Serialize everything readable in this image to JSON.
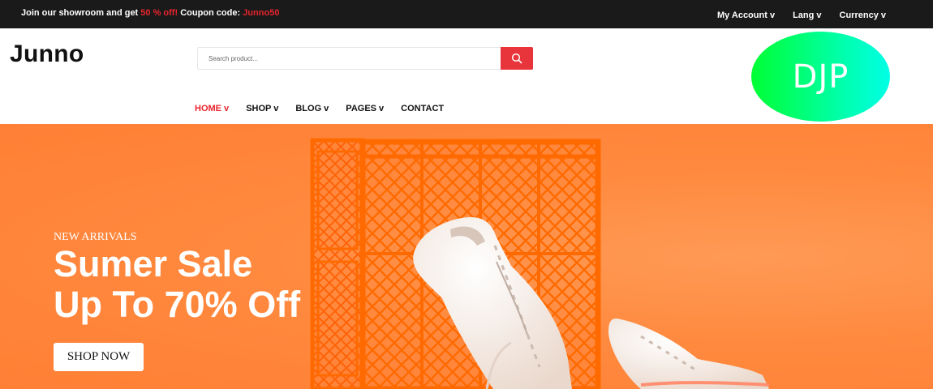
{
  "topbar": {
    "promo_prefix": "Join our showroom and get",
    "promo_discount": "50 % off!",
    "promo_code_label": "Coupon code:",
    "promo_code": "Junno50",
    "links": [
      "My Account v",
      "Lang v",
      "Currency v"
    ]
  },
  "header": {
    "logo": "Junno",
    "search_placeholder": "Search product...",
    "badge": "DJP"
  },
  "nav": {
    "items": [
      "HOME v",
      "SHOP v",
      "BLOG v",
      "PAGES v",
      "CONTACT"
    ]
  },
  "hero": {
    "eyebrow": "NEW ARRIVALS",
    "headline_line1": "Sumer Sale",
    "headline_line2": "Up To 70% Off",
    "cta": "SHOP NOW"
  },
  "colors": {
    "accent_red": "#e8242d",
    "topbar_bg": "#1a1a1a",
    "hero_orange": "#ff8a3f",
    "crate_orange": "#ff6a00"
  },
  "icons": {
    "search_button": "search-icon"
  }
}
